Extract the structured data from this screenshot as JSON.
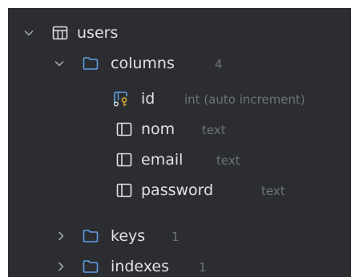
{
  "tree": {
    "table": {
      "label": "users",
      "icon": "table-icon",
      "expanded": true
    },
    "columns_folder": {
      "label": "columns",
      "count": "4",
      "icon": "folder-icon",
      "expanded": true
    },
    "columns": [
      {
        "name": "id",
        "type": "int (auto increment)",
        "icon": "primary-key-column-icon"
      },
      {
        "name": "nom",
        "type": "text",
        "icon": "column-icon"
      },
      {
        "name": "email",
        "type": "text",
        "icon": "column-icon"
      },
      {
        "name": "password",
        "type": "text",
        "icon": "column-icon"
      }
    ],
    "keys_folder": {
      "label": "keys",
      "count": "1",
      "icon": "folder-icon",
      "expanded": false
    },
    "indexes_folder": {
      "label": "indexes",
      "count": "1",
      "icon": "folder-icon",
      "expanded": false
    }
  },
  "colors": {
    "background": "#2b2d30",
    "text": "#dfe1e5",
    "muted": "#6f737a",
    "folder": "#5f9fe5",
    "chevron": "#9da0a8",
    "key": "#d4a63b"
  }
}
